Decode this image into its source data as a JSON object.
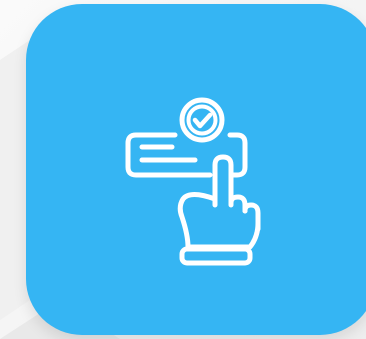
{
  "colors": {
    "background": "#f6f6f6",
    "tile": "#35b5f3",
    "icon_stroke": "#ffffff",
    "shadow": "#e6e6e6"
  },
  "icons": {
    "primary": "tap-to-confirm-icon",
    "parts": [
      "text-field-icon",
      "checkmark-badge-icon",
      "pointing-hand-icon"
    ]
  }
}
